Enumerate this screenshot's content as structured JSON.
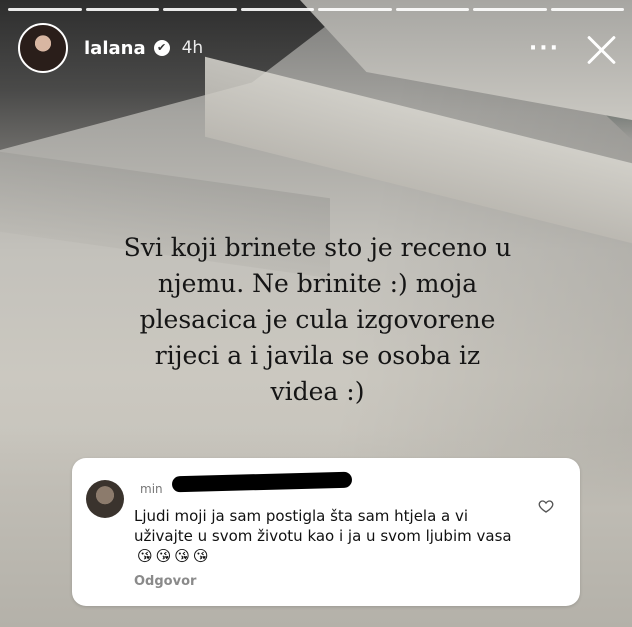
{
  "story": {
    "progress_segments": 8,
    "username": "lalana",
    "verified_glyph": "✔",
    "time_ago": "4h",
    "more_label": "···"
  },
  "caption": {
    "lines": [
      "Svi koji brinete sto je receno u",
      "njemu. Ne brinite :) moja",
      "plesacica je cula izgovorene",
      "rijeci a i javila se osoba iz",
      "videa :)"
    ]
  },
  "comment": {
    "username": "",
    "time": "min",
    "text": "Ljudi moji ja sam postigla šta sam htjela a vi uživajte u svom životu kao i ja u svom ljubim vasa",
    "emojis": [
      "😘",
      "😘",
      "😘",
      "😘"
    ],
    "reply_label": "Odgovor"
  },
  "colors": {
    "overlay_text": "#ffffff",
    "caption_text": "#151515",
    "card_bg": "#ffffff",
    "muted": "#8a8a8a"
  }
}
